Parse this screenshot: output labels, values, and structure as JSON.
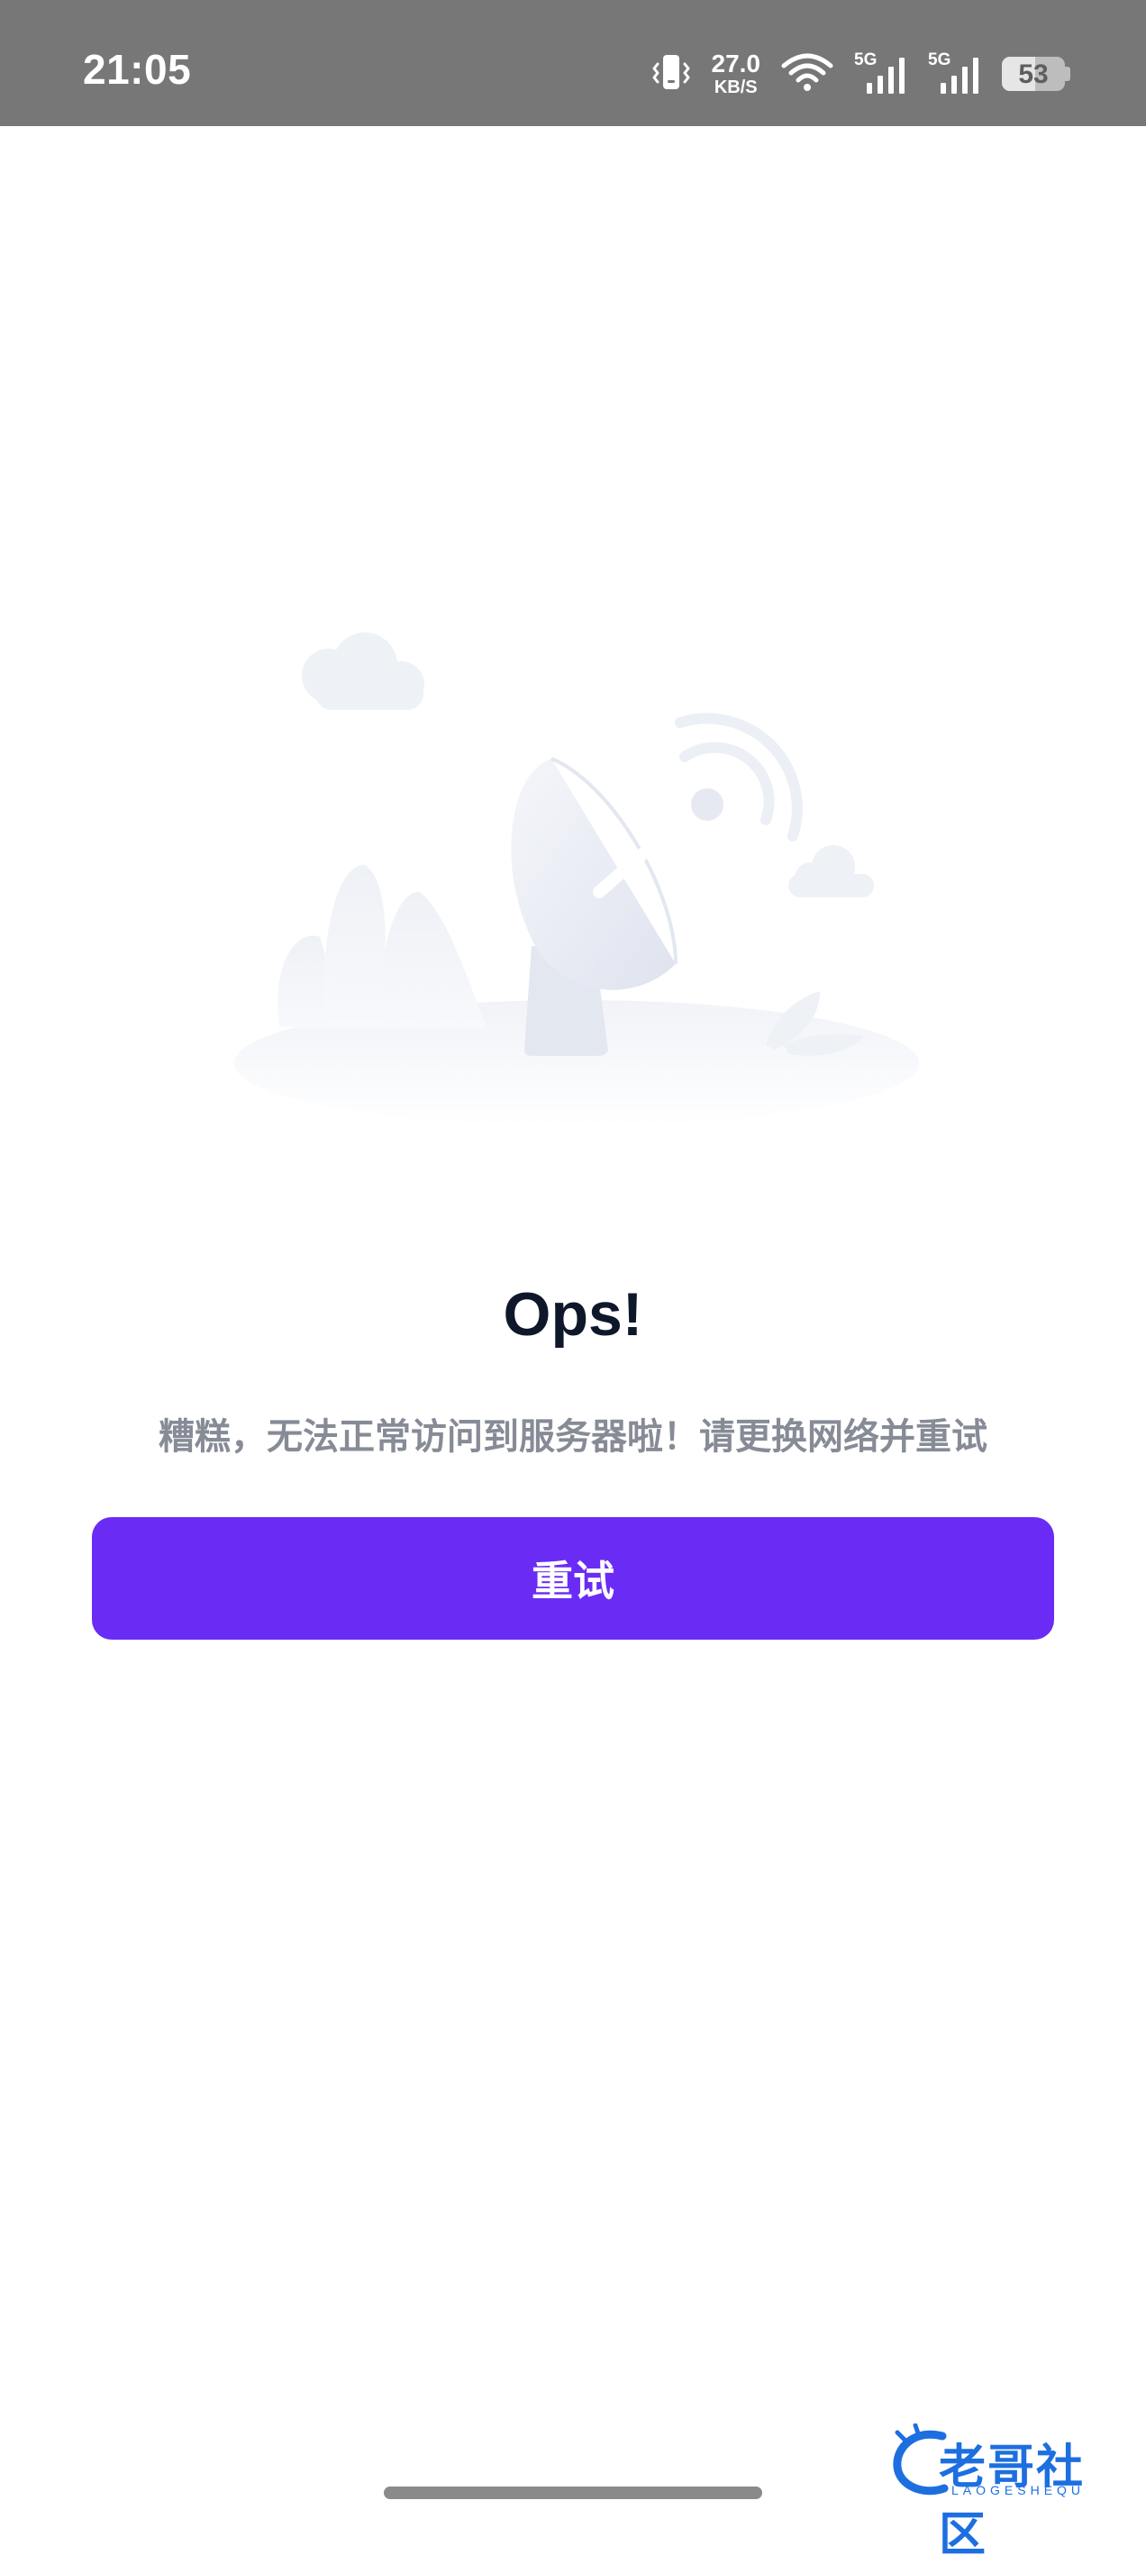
{
  "status_bar": {
    "time": "21:05",
    "net_speed_value": "27.0",
    "net_speed_unit": "KB/S",
    "signal_1_label": "5G",
    "signal_2_label": "5G",
    "battery_level": "53",
    "battery_fraction": 0.53,
    "icons": [
      "vibrate-icon",
      "wifi-icon",
      "signal-icon",
      "signal-icon",
      "battery-icon"
    ]
  },
  "error": {
    "illustration": "satellite-dish-illustration",
    "title": "Ops!",
    "message": "糟糕，无法正常访问到服务器啦！请更换网络并重试",
    "retry_label": "重试"
  },
  "watermark": {
    "text": "老哥社区",
    "subtext": "LAOGESHEQU"
  },
  "colors": {
    "status_bar": "#777777",
    "accent": "#6a2cf5",
    "title": "#0f172a",
    "message": "#868b96",
    "illustration": "#e6e9f2"
  }
}
